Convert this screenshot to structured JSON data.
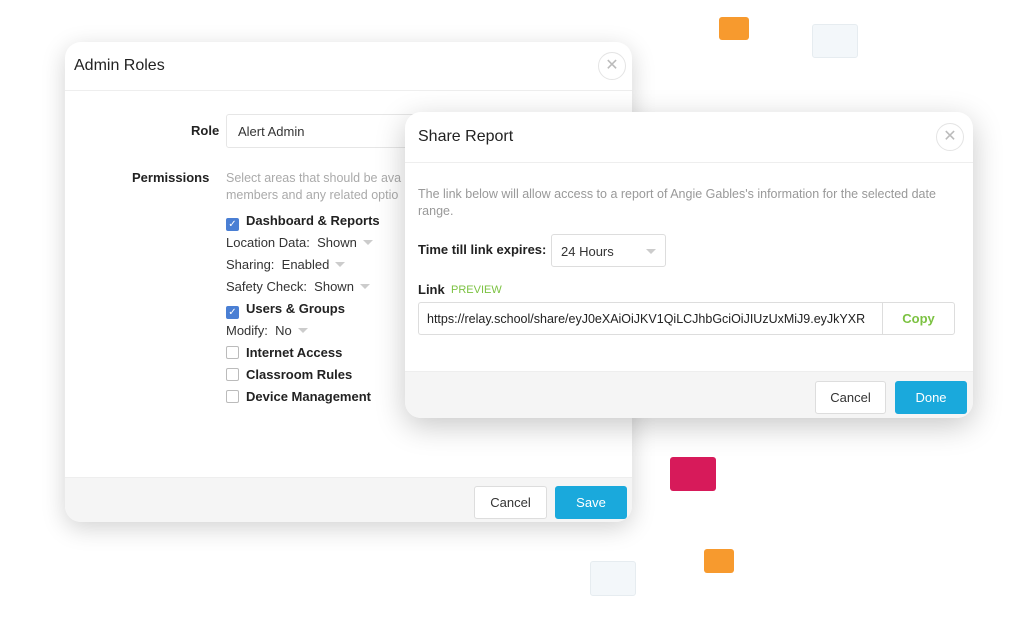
{
  "colors": {
    "accent": "#1aa9dc",
    "preview": "#7cc242",
    "decor_orange": "#f79a2e",
    "decor_crimson": "#d71a5a",
    "decor_light": "#f3f7fa"
  },
  "admin_roles": {
    "title": "Admin Roles",
    "role_label": "Role",
    "role_value": "Alert Admin",
    "permissions_label": "Permissions",
    "permissions_hint_line1": "Select areas that should be ava",
    "permissions_hint_line2": "members and any related optio",
    "items": [
      {
        "type": "checkbox",
        "label": "Dashboard & Reports",
        "checked": true
      },
      {
        "type": "option",
        "label": "Location Data:",
        "value": "Shown"
      },
      {
        "type": "option",
        "label": "Sharing:",
        "value": "Enabled"
      },
      {
        "type": "option",
        "label": "Safety Check:",
        "value": "Shown"
      },
      {
        "type": "checkbox",
        "label": "Users & Groups",
        "checked": true
      },
      {
        "type": "option",
        "label": "Modify:",
        "value": "No"
      },
      {
        "type": "checkbox",
        "label": "Internet Access",
        "checked": false
      },
      {
        "type": "checkbox",
        "label": "Classroom Rules",
        "checked": false
      },
      {
        "type": "checkbox",
        "label": "Device Management",
        "checked": false
      }
    ],
    "cancel_label": "Cancel",
    "save_label": "Save",
    "close_icon": "close-icon"
  },
  "share_report": {
    "title": "Share Report",
    "description": "The link below will allow access to a report of Angie Gables's information for the selected date range.",
    "expires_label": "Time till link expires:",
    "expires_value": "24 Hours",
    "link_label": "Link",
    "preview_label": "PREVIEW",
    "link_value": "https://relay.school/share/eyJ0eXAiOiJKV1QiLCJhbGciOiJIUzUxMiJ9.eyJkYXR",
    "copy_label": "Copy",
    "cancel_label": "Cancel",
    "done_label": "Done",
    "close_icon": "close-icon"
  }
}
